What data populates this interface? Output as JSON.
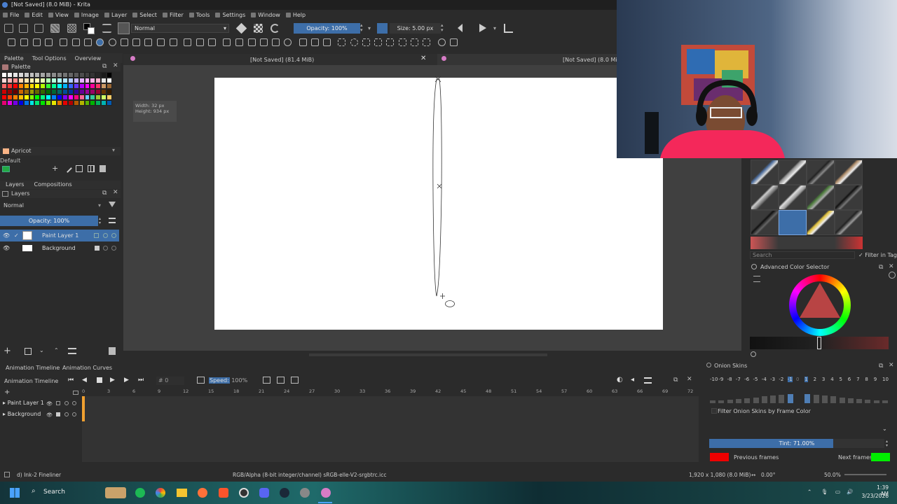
{
  "window": {
    "title": "[Not Saved] (8.0 MiB) - Krita"
  },
  "menu": {
    "items": [
      "File",
      "Edit",
      "View",
      "Image",
      "Layer",
      "Select",
      "Filter",
      "Tools",
      "Settings",
      "Window",
      "Help"
    ]
  },
  "toolbar": {
    "blend_mode": "Normal",
    "opacity": "Opacity: 100%",
    "size": "Size: 5.00 px"
  },
  "docker_tabs": [
    "Palette",
    "Tool Options",
    "Overview"
  ],
  "palette": {
    "title": "Palette",
    "selected_color_name": "Apricot",
    "preset_name": "Default",
    "swatch_colors": [
      "#ffffff",
      "#f2f2f2",
      "#e6e6e6",
      "#d9d9d9",
      "#cccccc",
      "#bfbfbf",
      "#b3b3b3",
      "#a6a6a6",
      "#999999",
      "#8c8c8c",
      "#808080",
      "#737373",
      "#666666",
      "#595959",
      "#4d4d4d",
      "#404040",
      "#333333",
      "#262626",
      "#1a1a1a",
      "#000000",
      "#ffd9d9",
      "#ffb3b3",
      "#ff8c8c",
      "#ffd9b3",
      "#ffe6b3",
      "#fff2b3",
      "#ffffb3",
      "#e6ffb3",
      "#b3ffb3",
      "#b3ffd9",
      "#b3ffff",
      "#b3e6ff",
      "#b3ccff",
      "#c6b3ff",
      "#e0b3ff",
      "#ffb3ff",
      "#ffb3e6",
      "#ffb3cc",
      "#e6e6e6",
      "#ffffff",
      "#ff6666",
      "#ff3333",
      "#ff0000",
      "#ff8000",
      "#ffb300",
      "#ffd900",
      "#ffff00",
      "#b3ff00",
      "#33ff33",
      "#00ff99",
      "#00ffff",
      "#00b3ff",
      "#3366ff",
      "#6633ff",
      "#b300ff",
      "#ff00ff",
      "#ff0099",
      "#ff3366",
      "#cc9966",
      "#996633",
      "#cc0000",
      "#990000",
      "#660000",
      "#cc6600",
      "#996600",
      "#999900",
      "#666600",
      "#336600",
      "#006600",
      "#006633",
      "#006666",
      "#004d99",
      "#003399",
      "#330099",
      "#660099",
      "#990099",
      "#990066",
      "#990033",
      "#663300",
      "#331a00",
      "#ff0000",
      "#ff4000",
      "#ff8000",
      "#ffbf00",
      "#ffff00",
      "#80ff00",
      "#00ff00",
      "#00ff80",
      "#00ffff",
      "#0080ff",
      "#0000ff",
      "#8000ff",
      "#ff00ff",
      "#ff0080",
      "#ff6699",
      "#66ccff",
      "#33cc99",
      "#99cc33",
      "#ccff66",
      "#ffcc66",
      "#e60073",
      "#e600e6",
      "#7300e6",
      "#0000e6",
      "#0073e6",
      "#00e6e6",
      "#00e673",
      "#00e600",
      "#73e600",
      "#e6e600",
      "#e67300",
      "#e60000",
      "#b30000",
      "#b35900",
      "#b3b300",
      "#59b300",
      "#00b300",
      "#00b359",
      "#00b3b3",
      "#0059b3"
    ]
  },
  "layers": {
    "tabs": [
      "Layers",
      "Compositions"
    ],
    "blend": "Normal",
    "opacity": "Opacity: 100%",
    "items": [
      "Paint Layer 1",
      "Background"
    ]
  },
  "canvas": {
    "tab_left": "[Not Saved]  (81.4 MiB)",
    "tab_right": "[Not Saved]  (8.0 MiB)",
    "size_hint_width": "Width: 32 px",
    "size_hint_height": "Height: 934 px"
  },
  "brushes": {
    "search_placeholder": "Search",
    "filter_label": "Filter in Tag"
  },
  "color_selector": {
    "title": "Advanced Color Selector"
  },
  "timeline": {
    "tabs": [
      "Animation Timeline",
      "Animation Curves"
    ],
    "label": "Animation Timeline",
    "frame_field": "0",
    "speed_label": "Speed:",
    "speed_value": "100%",
    "ruler": [
      "0",
      "3",
      "6",
      "9",
      "12",
      "15",
      "18",
      "21",
      "24",
      "27",
      "30",
      "33",
      "36",
      "39",
      "42",
      "45",
      "48",
      "51",
      "54",
      "57",
      "60",
      "63",
      "66",
      "69",
      "72"
    ],
    "layers": [
      "Paint Layer 1",
      "Background"
    ]
  },
  "onion": {
    "title": "Onion Skins",
    "numbers": [
      "-10",
      "-9",
      "-8",
      "-7",
      "-6",
      "-5",
      "-4",
      "-3",
      "-2",
      "-1",
      "0",
      "1",
      "2",
      "3",
      "4",
      "5",
      "6",
      "7",
      "8",
      "9",
      "10"
    ],
    "filter_label": "Filter Onion Skins by Frame Color",
    "tint": "Tint: 71.00%",
    "previous_label": "Previous frames",
    "next_label": "Next frames",
    "previous_color": "#ee0000",
    "next_color": "#00ee00"
  },
  "status": {
    "brush": "d) Ink-2 Fineliner",
    "color_space": "RGB/Alpha (8-bit integer/channel)  sRGB-elle-V2-srgbtrc.icc",
    "image_size": "1,920 x 1,080 (8.0 MiB)",
    "rotation": "0.00°",
    "zoom": "50.0%"
  },
  "taskbar": {
    "search": "Search",
    "time": "1:39 AM",
    "date": "3/23/2026"
  },
  "accent_color": "#3d6ea8"
}
